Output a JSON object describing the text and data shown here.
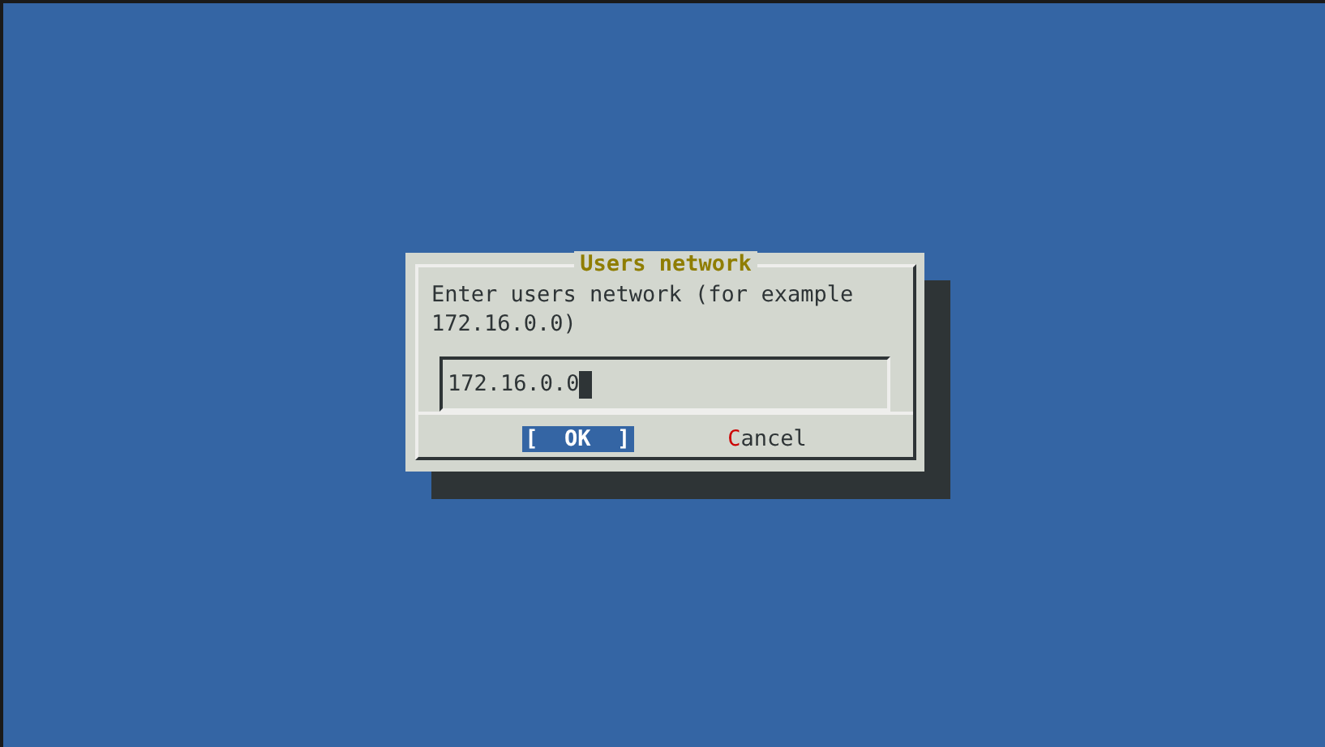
{
  "dialog": {
    "title": "Users network",
    "prompt": "Enter users network (for example 172.16.0.0)",
    "input": {
      "value": "172.16.0.0",
      "focused": true
    },
    "buttons": [
      {
        "label": "OK",
        "left": "[",
        "right": "]",
        "selected": true,
        "hotkey_first": true
      },
      {
        "label": "Cancel",
        "selected": false,
        "hotkey_first": true
      }
    ]
  }
}
